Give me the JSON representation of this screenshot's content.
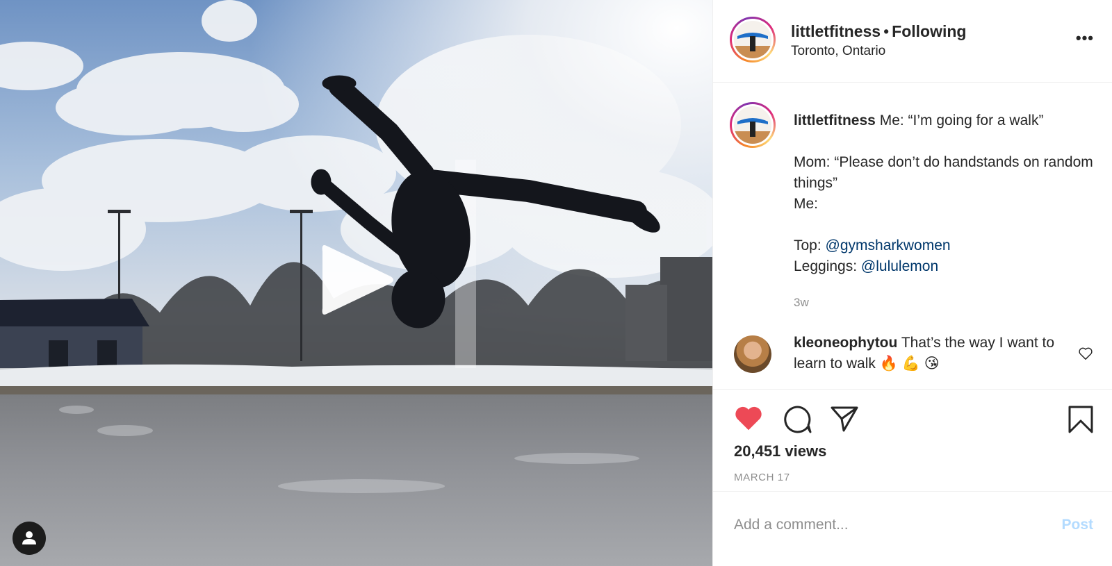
{
  "post": {
    "username": "littletfitness",
    "separator": "•",
    "follow_status": "Following",
    "location": "Toronto, Ontario",
    "more_label": "•••"
  },
  "caption": {
    "username": "littletfitness",
    "line1": "Me: “I’m going for a walk”",
    "line2": "Mom: “Please don’t do handstands on random things”",
    "line3": "Me:",
    "top_label": "Top:",
    "top_mention": "@gymsharkwomen",
    "leggings_label": "Leggings:",
    "leggings_mention": "@lululemon",
    "time_ago": "3w"
  },
  "comment": {
    "username": "kleoneophytou",
    "text": "That’s the way I want to learn to walk 🔥 💪 😘"
  },
  "stats": {
    "views": "20,451 views",
    "date": "MARCH 17"
  },
  "composer": {
    "placeholder": "Add a comment...",
    "post_label": "Post"
  },
  "colors": {
    "like_red": "#ed4956",
    "link_blue": "#00376b",
    "post_disabled": "#b3dbff"
  },
  "icons": {
    "like": "heart-filled-icon",
    "comment": "speech-bubble-icon",
    "share": "paper-plane-icon",
    "save": "bookmark-icon",
    "play": "play-icon",
    "tagged_user": "user-silhouette-icon"
  }
}
